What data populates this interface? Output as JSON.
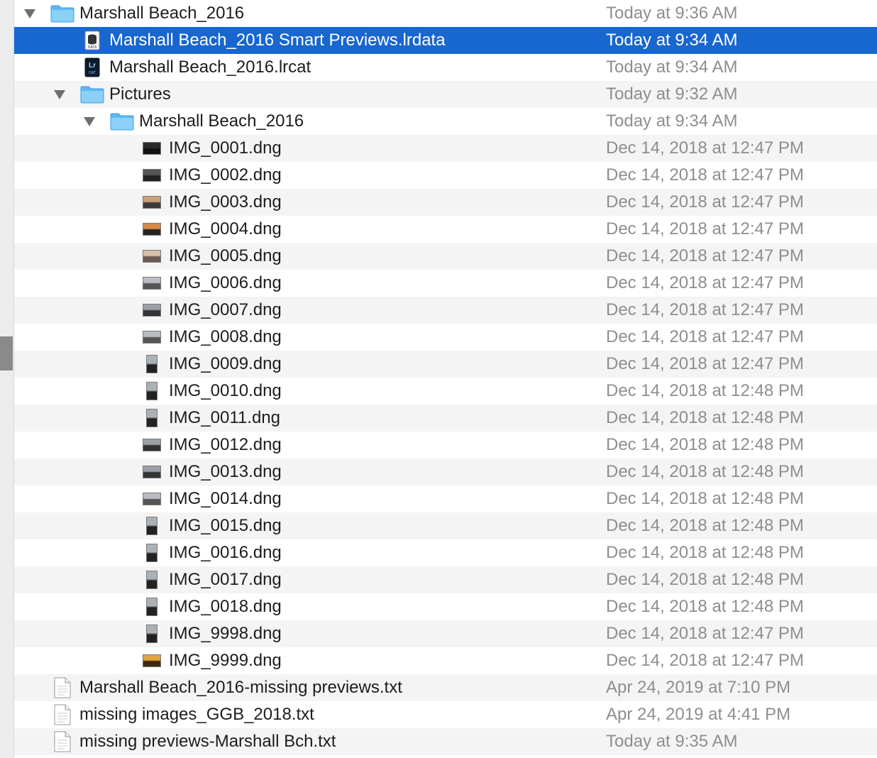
{
  "rows": [
    {
      "name": "Marshall Beach_2016",
      "date": "Today at 9:36 AM",
      "depth": 0,
      "kind": "folder",
      "expanded": true
    },
    {
      "name": "Marshall Beach_2016 Smart Previews.lrdata",
      "date": "Today at 9:34 AM",
      "depth": 1,
      "kind": "lrdata",
      "selected": true
    },
    {
      "name": "Marshall Beach_2016.lrcat",
      "date": "Today at 9:34 AM",
      "depth": 1,
      "kind": "lrcat"
    },
    {
      "name": "Pictures",
      "date": "Today at 9:32 AM",
      "depth": 1,
      "kind": "folder",
      "expanded": true
    },
    {
      "name": "Marshall Beach_2016",
      "date": "Today at 9:34 AM",
      "depth": 2,
      "kind": "folder",
      "expanded": true
    },
    {
      "name": "IMG_0001.dng",
      "date": "Dec 14, 2018 at 12:47 PM",
      "depth": 3,
      "kind": "image",
      "thumb": "dark"
    },
    {
      "name": "IMG_0002.dng",
      "date": "Dec 14, 2018 at 12:47 PM",
      "depth": 3,
      "kind": "image",
      "thumb": "dark2"
    },
    {
      "name": "IMG_0003.dng",
      "date": "Dec 14, 2018 at 12:47 PM",
      "depth": 3,
      "kind": "image",
      "thumb": "sunset"
    },
    {
      "name": "IMG_0004.dng",
      "date": "Dec 14, 2018 at 12:47 PM",
      "depth": 3,
      "kind": "image",
      "thumb": "sunset2"
    },
    {
      "name": "IMG_0005.dng",
      "date": "Dec 14, 2018 at 12:47 PM",
      "depth": 3,
      "kind": "image",
      "thumb": "sunset3"
    },
    {
      "name": "IMG_0006.dng",
      "date": "Dec 14, 2018 at 12:47 PM",
      "depth": 3,
      "kind": "image",
      "thumb": "grey"
    },
    {
      "name": "IMG_0007.dng",
      "date": "Dec 14, 2018 at 12:47 PM",
      "depth": 3,
      "kind": "image",
      "thumb": "grey2"
    },
    {
      "name": "IMG_0008.dng",
      "date": "Dec 14, 2018 at 12:47 PM",
      "depth": 3,
      "kind": "image",
      "thumb": "grey"
    },
    {
      "name": "IMG_0009.dng",
      "date": "Dec 14, 2018 at 12:47 PM",
      "depth": 3,
      "kind": "image",
      "thumb": "portrait"
    },
    {
      "name": "IMG_0010.dng",
      "date": "Dec 14, 2018 at 12:48 PM",
      "depth": 3,
      "kind": "image",
      "thumb": "portrait"
    },
    {
      "name": "IMG_0011.dng",
      "date": "Dec 14, 2018 at 12:48 PM",
      "depth": 3,
      "kind": "image",
      "thumb": "portrait"
    },
    {
      "name": "IMG_0012.dng",
      "date": "Dec 14, 2018 at 12:48 PM",
      "depth": 3,
      "kind": "image",
      "thumb": "grey2"
    },
    {
      "name": "IMG_0013.dng",
      "date": "Dec 14, 2018 at 12:48 PM",
      "depth": 3,
      "kind": "image",
      "thumb": "grey2"
    },
    {
      "name": "IMG_0014.dng",
      "date": "Dec 14, 2018 at 12:48 PM",
      "depth": 3,
      "kind": "image",
      "thumb": "grey"
    },
    {
      "name": "IMG_0015.dng",
      "date": "Dec 14, 2018 at 12:48 PM",
      "depth": 3,
      "kind": "image",
      "thumb": "portrait"
    },
    {
      "name": "IMG_0016.dng",
      "date": "Dec 14, 2018 at 12:48 PM",
      "depth": 3,
      "kind": "image",
      "thumb": "portrait"
    },
    {
      "name": "IMG_0017.dng",
      "date": "Dec 14, 2018 at 12:48 PM",
      "depth": 3,
      "kind": "image",
      "thumb": "portrait"
    },
    {
      "name": "IMG_0018.dng",
      "date": "Dec 14, 2018 at 12:48 PM",
      "depth": 3,
      "kind": "image",
      "thumb": "portrait"
    },
    {
      "name": "IMG_9998.dng",
      "date": "Dec 14, 2018 at 12:47 PM",
      "depth": 3,
      "kind": "image",
      "thumb": "portrait"
    },
    {
      "name": "IMG_9999.dng",
      "date": "Dec 14, 2018 at 12:47 PM",
      "depth": 3,
      "kind": "image",
      "thumb": "golden"
    },
    {
      "name": "Marshall Beach_2016-missing previews.txt",
      "date": "Apr 24, 2019 at 7:10 PM",
      "depth": 0,
      "kind": "txt"
    },
    {
      "name": "missing images_GGB_2018.txt",
      "date": "Apr 24, 2019 at 4:41 PM",
      "depth": 0,
      "kind": "txt"
    },
    {
      "name": "missing previews-Marshall Bch.txt",
      "date": "Today at 9:35 AM",
      "depth": 0,
      "kind": "txt"
    }
  ],
  "colors": {
    "selection": "#1866d0",
    "folder": "#5eb8f2",
    "date_text": "#8e8e8e"
  }
}
